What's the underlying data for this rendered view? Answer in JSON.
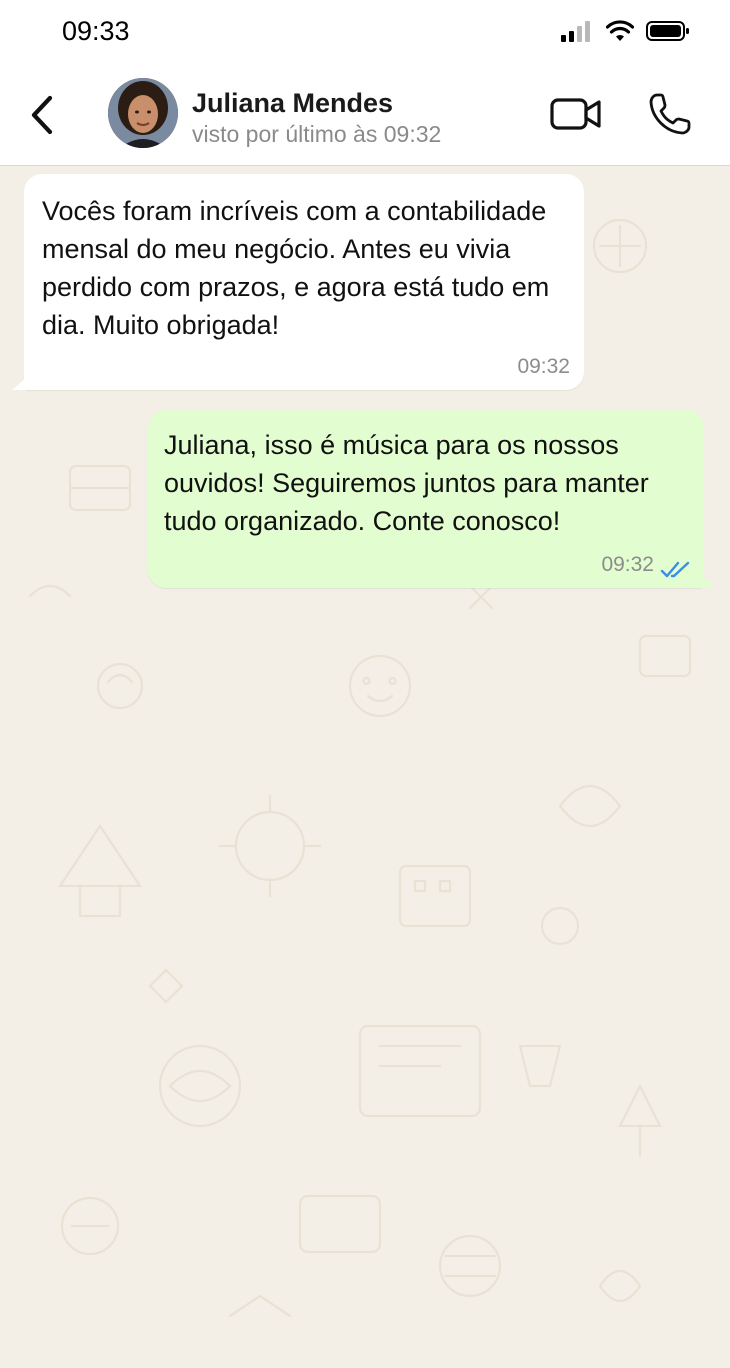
{
  "status_bar": {
    "time": "09:33",
    "icons": [
      "signal-icon",
      "wifi-icon",
      "battery-icon"
    ]
  },
  "header": {
    "back_icon": "chevron-left-icon",
    "contact_name": "Juliana Mendes",
    "contact_status": "visto por último às 09:32",
    "actions": [
      "video-call-icon",
      "phone-icon"
    ]
  },
  "messages": [
    {
      "direction": "incoming",
      "text": "Vocês foram incríveis com a contabilidade mensal do meu negócio. Antes eu vivia perdido com prazos, e agora está tudo em dia. Muito obrigada!",
      "time": "09:32"
    },
    {
      "direction": "outgoing",
      "text": "Juliana, isso é música para os nossos ouvidos! Seguiremos juntos para manter tudo organizado. Conte conosco!",
      "time": "09:32",
      "status": "read"
    }
  ],
  "colors": {
    "chat_background": "#f3efe6",
    "incoming_bubble": "#ffffff",
    "outgoing_bubble": "#e2fdcf",
    "read_ticks": "#3a8ee6"
  }
}
